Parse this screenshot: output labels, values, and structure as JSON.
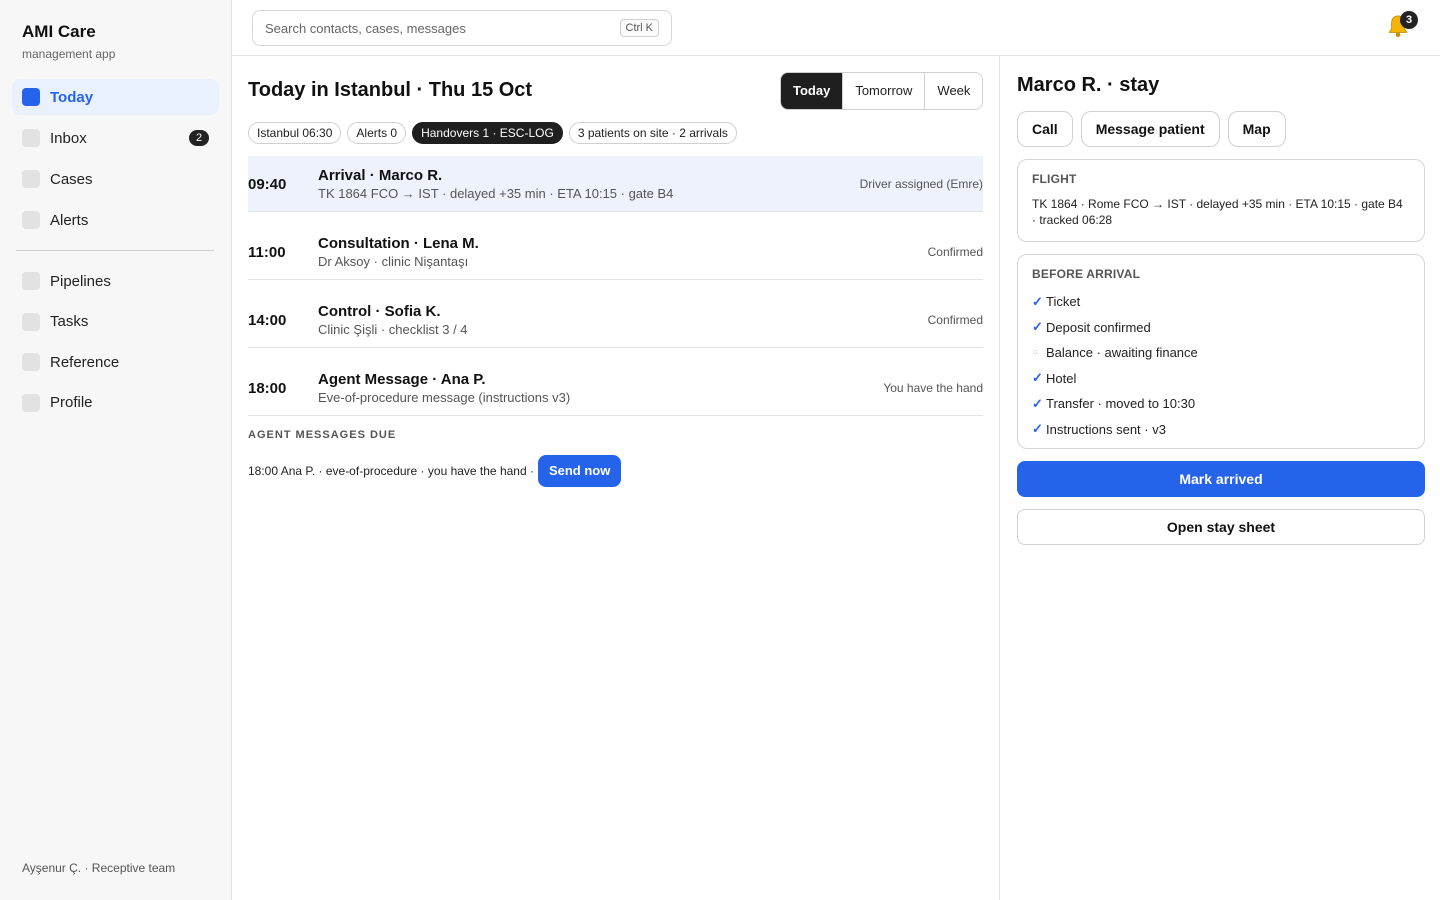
{
  "brand": {
    "title": "AMI Care",
    "subtitle": "management app"
  },
  "sidebar": {
    "primary": [
      {
        "label": "Today",
        "active": true
      },
      {
        "label": "Inbox",
        "badge": "2"
      },
      {
        "label": "Cases"
      },
      {
        "label": "Alerts"
      }
    ],
    "secondary": [
      {
        "label": "Pipelines"
      },
      {
        "label": "Tasks"
      },
      {
        "label": "Reference"
      },
      {
        "label": "Profile"
      }
    ],
    "footer": "Ayşenur Ç. · Receptive team"
  },
  "search": {
    "placeholder": "Search contacts, cases, messages",
    "shortcut": "Ctrl K"
  },
  "notifications": {
    "count": "3"
  },
  "main": {
    "title": "Today in Istanbul · Thu 15 Oct",
    "range_tabs": [
      "Today",
      "Tomorrow",
      "Week"
    ],
    "active_tab": "Today",
    "pills": [
      "Istanbul 06:30",
      "Alerts 0",
      "Handovers 1 · ESC-LOG",
      "3 patients on site · 2 arrivals"
    ],
    "schedule": [
      {
        "time": "09:40",
        "title": "Arrival · Marco R.",
        "sub": "TK 1864 FCO → IST · delayed +35 min · ETA 10:15 · gate B4",
        "status": "Driver assigned (Emre)",
        "selected": true
      },
      {
        "time": "11:00",
        "title": "Consultation · Lena M.",
        "sub": "Dr Aksoy · clinic Nişantaşı",
        "status": "Confirmed"
      },
      {
        "time": "14:00",
        "title": "Control · Sofia K.",
        "sub": "Clinic Şişli · checklist 3 / 4",
        "status": "Confirmed"
      },
      {
        "time": "18:00",
        "title": "Agent Message · Ana P.",
        "sub": "Eve-of-procedure message (instructions v3)",
        "status": "You have the hand"
      }
    ],
    "due": {
      "heading": "AGENT MESSAGES DUE",
      "text": "18:00 Ana P. · eve-of-procedure · you have the hand ·",
      "button": "Send now"
    }
  },
  "panel": {
    "title": "Marco R. · stay",
    "actions": [
      "Call",
      "Message patient",
      "Map"
    ],
    "flight": {
      "heading": "FLIGHT",
      "text": "TK 1864 · Rome FCO → IST · delayed +35 min · ETA 10:15 · gate B4 · tracked 06:28"
    },
    "before_arrival": {
      "heading": "BEFORE ARRIVAL",
      "items": [
        {
          "label": "Ticket",
          "done": true
        },
        {
          "label": "Deposit confirmed",
          "done": true
        },
        {
          "label": "Balance · awaiting finance",
          "done": false
        },
        {
          "label": "Hotel",
          "done": true
        },
        {
          "label": "Transfer · moved to 10:30",
          "done": true
        },
        {
          "label": "Instructions sent · v3",
          "done": true
        }
      ]
    },
    "primary_button": "Mark arrived",
    "secondary_button": "Open stay sheet"
  },
  "colors": {
    "accent": "#2563eb",
    "dark": "#1f1f1f",
    "selected_row": "#edf2fd"
  }
}
